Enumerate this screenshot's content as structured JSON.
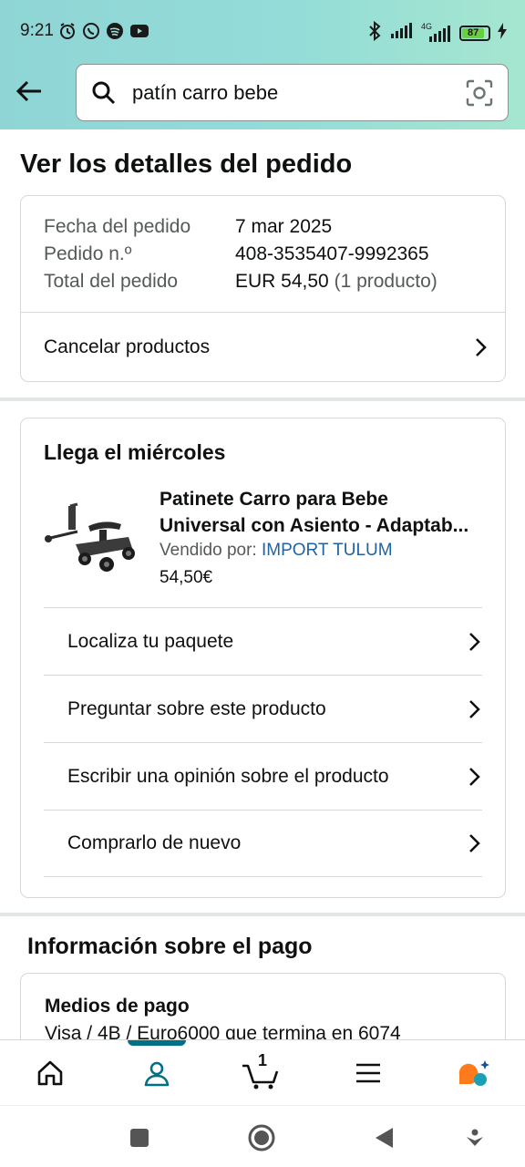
{
  "status_bar": {
    "time": "9:21",
    "battery": "87",
    "network": "4G"
  },
  "search": {
    "value": "patín carro bebe"
  },
  "page": {
    "title": "Ver los detalles del pedido"
  },
  "order_summary": {
    "date_label": "Fecha del pedido",
    "date_value": "7 mar 2025",
    "number_label": "Pedido n.º",
    "number_value": "408-3535407-9992365",
    "total_label": "Total del pedido",
    "total_value": "EUR 54,50",
    "total_count": "(1 producto)",
    "cancel_label": "Cancelar productos"
  },
  "delivery": {
    "title": "Llega el miércoles",
    "product": {
      "title_line1": "Patinete Carro para Bebe",
      "title_line2": "Universal con Asiento - Adaptab...",
      "seller_prefix": "Vendido por:",
      "seller_name": "IMPORT TULUM",
      "price": "54,50€"
    },
    "actions": [
      {
        "label": "Localiza tu paquete"
      },
      {
        "label": "Preguntar sobre este producto"
      },
      {
        "label": "Escribir una opinión sobre el producto"
      },
      {
        "label": "Comprarlo de nuevo"
      }
    ]
  },
  "payment": {
    "section_title": "Información sobre el pago",
    "methods_label": "Medios de pago",
    "method_value": "Visa / 4B / Euro6000 que termina en 6074"
  },
  "bottom_nav": {
    "cart_count": "1",
    "items": [
      "home-icon",
      "account-icon",
      "cart-icon",
      "menu-icon",
      "rufus-icon"
    ],
    "accent": "#007185"
  },
  "colors": {
    "header_gradient_start": "#8fd5d6",
    "header_gradient_end": "#a5e6cf",
    "link": "#2162a1",
    "text": "#0f1111",
    "muted": "#565959"
  }
}
